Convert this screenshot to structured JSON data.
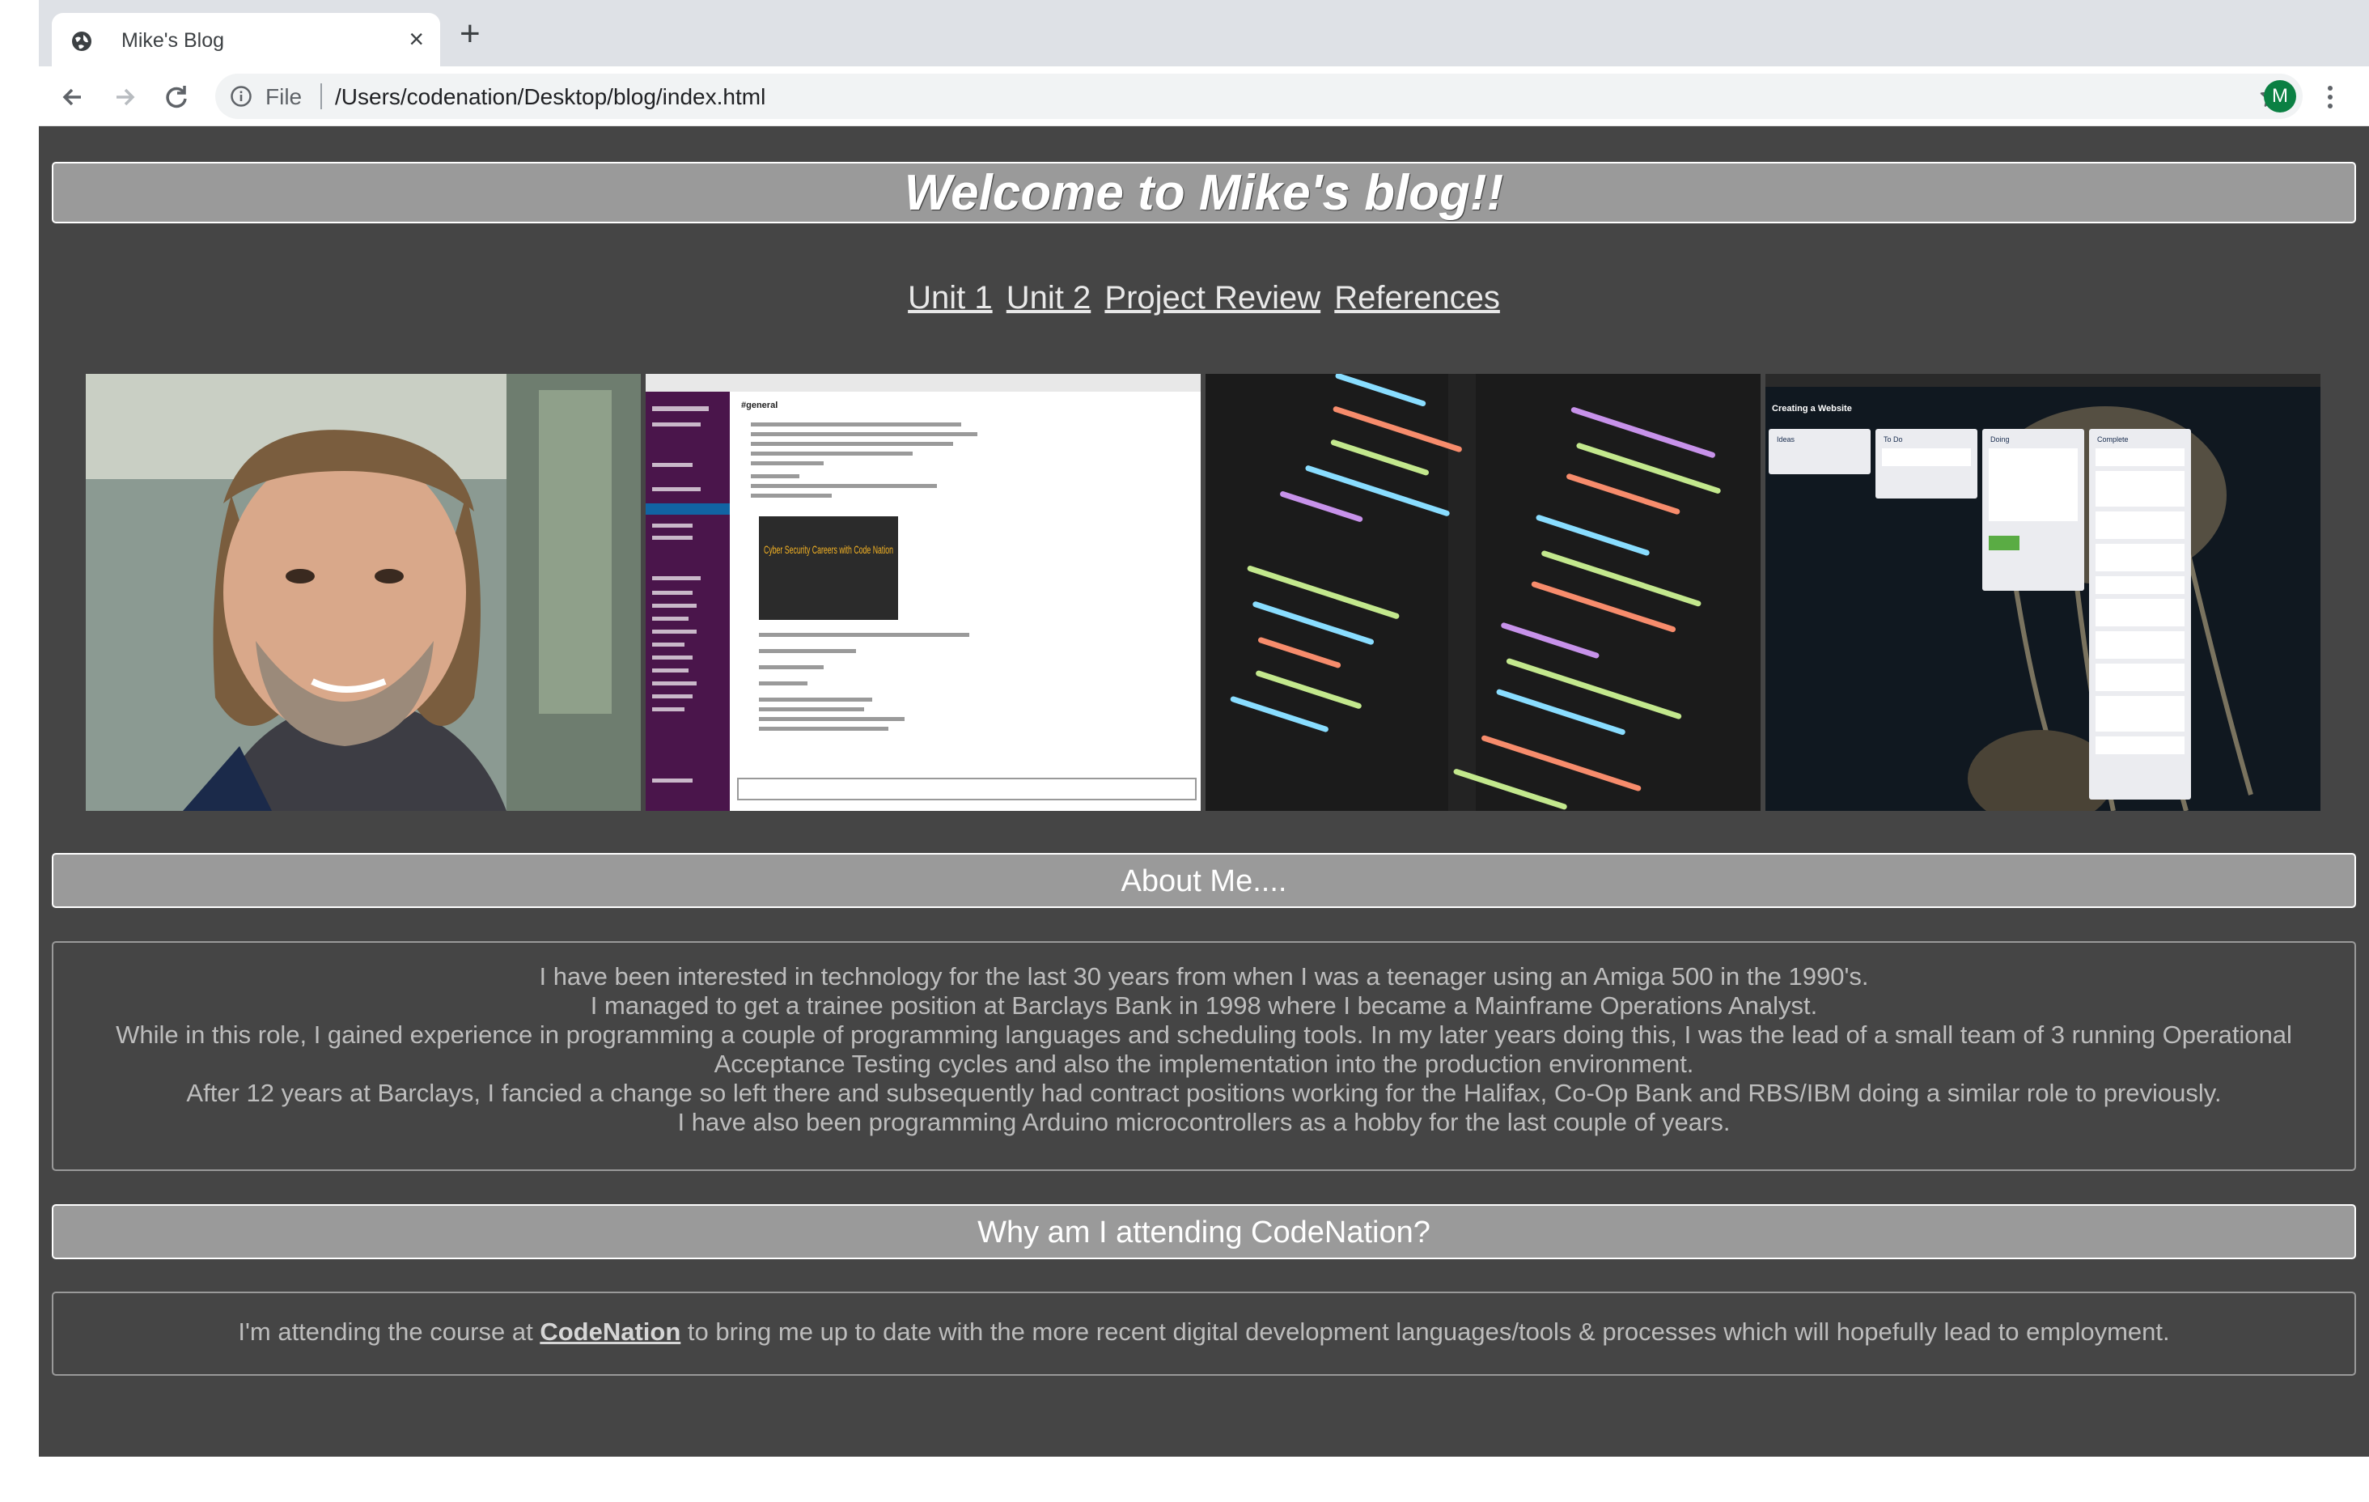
{
  "browser": {
    "tab_title": "Mike's Blog",
    "url_scheme": "File",
    "url": "/Users/codenation/Desktop/blog/index.html",
    "avatar_letter": "M",
    "icons": [
      "globe-icon",
      "close-icon",
      "plus-icon",
      "back-icon",
      "forward-icon",
      "reload-icon",
      "info-icon",
      "star-icon",
      "more-vert-icon"
    ]
  },
  "page": {
    "title": "Welcome to Mike's blog!!",
    "nav": [
      "Unit 1",
      "Unit 2",
      "Project Review",
      "References"
    ],
    "gallery": [
      {
        "name": "portrait-photo",
        "alt": "Photo of Mike"
      },
      {
        "name": "slack-screenshot",
        "alt": "Slack channel screenshot",
        "heading": "#general",
        "poster": "Cyber Security Careers with Code Nation"
      },
      {
        "name": "code-screenshot",
        "alt": "Code editor screenshot"
      },
      {
        "name": "trello-screenshot",
        "alt": "Trello board screenshot",
        "board_title": "Creating a Website",
        "columns": [
          "Ideas",
          "To Do",
          "Doing",
          "Complete"
        ]
      }
    ],
    "about": {
      "heading": "About Me....",
      "lines": [
        "I have been interested in technology for the last 30 years from when I was a teenager using an Amiga 500 in the 1990's.",
        "I managed to get a trainee position at Barclays Bank in 1998 where I became a Mainframe Operations Analyst.",
        "While in this role, I gained experience in programming a couple of programming languages and scheduling tools. In my later years doing this, I was the lead of a small team of 3 running Operational",
        "Acceptance Testing cycles and also the implementation into the production environment.",
        "After 12 years at Barclays, I fancied a change so left there and subsequently had contract positions working for the Halifax, Co-Op Bank and RBS/IBM doing a similar role to previously.",
        "I have also been programming Arduino microcontrollers as a hobby for the last couple of years."
      ]
    },
    "why": {
      "heading": "Why am I attending CodeNation?",
      "text_before": "I'm attending the course at ",
      "link": "CodeNation",
      "text_after": " to bring me up to date with the more recent digital development languages/tools & processes which will hopefully lead to employment."
    }
  }
}
